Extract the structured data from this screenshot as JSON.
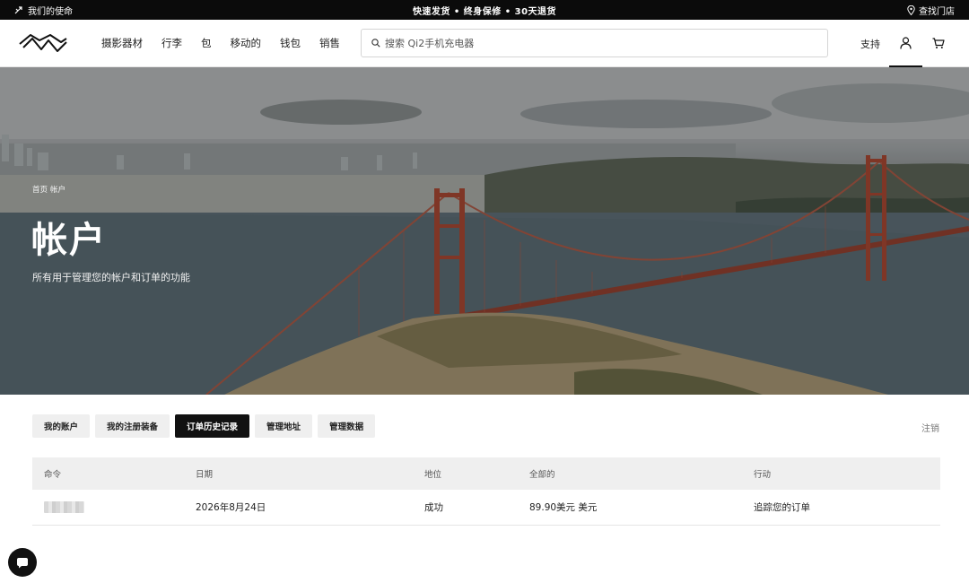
{
  "topbar": {
    "mission": "我们的使命",
    "promo": "快速发货 • 终身保修 • 30天退货",
    "store": "查找门店"
  },
  "header": {
    "nav": [
      "摄影器材",
      "行李",
      "包",
      "移动的",
      "钱包",
      "销售"
    ],
    "search_placeholder": "搜索 Qi2手机充电器",
    "support": "支持"
  },
  "hero": {
    "breadcrumb": [
      "首页",
      "帐户"
    ],
    "title": "帐户",
    "subtitle": "所有用于管理您的帐户和订单的功能"
  },
  "tabs": [
    {
      "label": "我的账户",
      "active": false
    },
    {
      "label": "我的注册装备",
      "active": false
    },
    {
      "label": "订单历史记录",
      "active": true
    },
    {
      "label": "管理地址",
      "active": false
    },
    {
      "label": "管理数据",
      "active": false
    }
  ],
  "logout": "注销",
  "orders": {
    "columns": [
      "命令",
      "日期",
      "地位",
      "全部的",
      "行动"
    ],
    "rows": [
      {
        "order": "",
        "date": "2026年8月24日",
        "status": "成功",
        "total": "89.90美元  美元",
        "action": "追踪您的订单"
      }
    ]
  },
  "colors": {
    "topbar_bg": "#0b0b0b",
    "active_tab": "#111111",
    "bridge": "#8a3b2a"
  }
}
